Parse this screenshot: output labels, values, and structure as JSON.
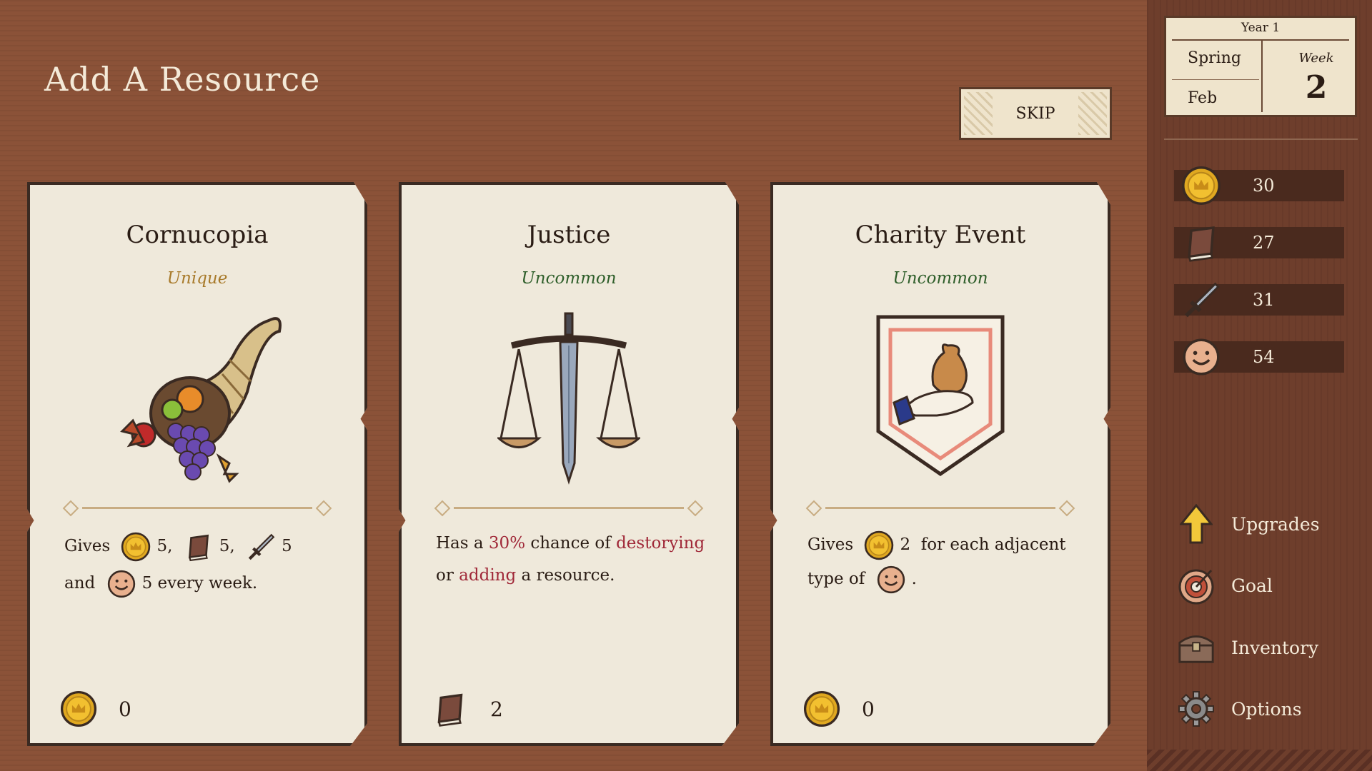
{
  "header": {
    "title": "Add A Resource",
    "skip_label": "SKIP"
  },
  "cards": [
    {
      "name": "Cornucopia",
      "rarity": "Unique",
      "desc": {
        "gives": "Gives",
        "v1": "5",
        "sep1": ",",
        "v2": "5",
        "sep2": ",",
        "v3": "5",
        "and": "and",
        "v4": "5",
        "tail": "every week."
      },
      "cost": "0",
      "icons": [
        "coin-icon",
        "book-icon",
        "sword-icon",
        "smiley-icon"
      ]
    },
    {
      "name": "Justice",
      "rarity": "Uncommon",
      "desc": {
        "p1": "Has a",
        "pct": "30%",
        "p2": "chance of",
        "w1": "destorying",
        "p3": "or",
        "w2": "adding",
        "p4": "a resource."
      },
      "cost": "2",
      "icons": [
        "book-icon"
      ]
    },
    {
      "name": "Charity Event",
      "rarity": "Uncommon",
      "desc": {
        "gives": "Gives",
        "v1": "2",
        "p1": "for each adjacent",
        "p2": "type of",
        "end": "."
      },
      "cost": "0",
      "icons": [
        "coin-icon",
        "smiley-icon"
      ]
    }
  ],
  "calendar": {
    "year": "Year 1",
    "season": "Spring",
    "month": "Feb",
    "week_label": "Week",
    "week": "2"
  },
  "resources": [
    {
      "icon": "coin-icon",
      "value": "30"
    },
    {
      "icon": "book-icon",
      "value": "27"
    },
    {
      "icon": "sword-icon",
      "value": "31"
    },
    {
      "icon": "smiley-icon",
      "value": "54"
    }
  ],
  "menu": [
    {
      "icon": "arrow-up-icon",
      "label": "Upgrades"
    },
    {
      "icon": "target-icon",
      "label": "Goal"
    },
    {
      "icon": "chest-icon",
      "label": "Inventory"
    },
    {
      "icon": "gear-icon",
      "label": "Options"
    }
  ],
  "colors": {
    "rarity_unique": "#a87a2a",
    "rarity_uncommon": "#2e5e2a",
    "highlight_red": "#a02838",
    "background": "#8b5238",
    "sidebar": "#6e3e2c"
  }
}
